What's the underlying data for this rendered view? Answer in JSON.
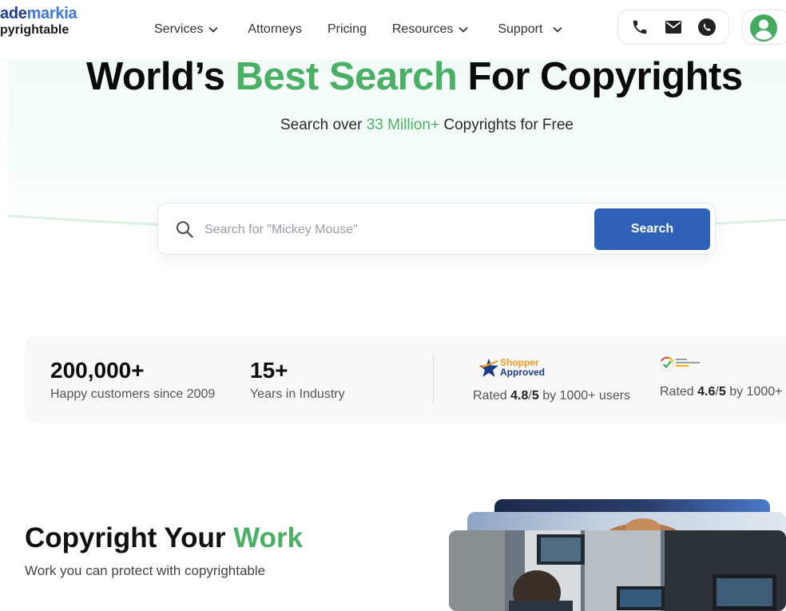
{
  "brand": {
    "line1_part1": "ade",
    "line1_part2": "markia",
    "line2": "pyrightable",
    "colors": {
      "dark_blue": "#1e3d8f",
      "light_blue": "#3f77d2"
    }
  },
  "nav": {
    "items": [
      {
        "label": "Services",
        "has_dropdown": true
      },
      {
        "label": "Attorneys",
        "has_dropdown": false
      },
      {
        "label": "Pricing",
        "has_dropdown": false
      },
      {
        "label": "Resources",
        "has_dropdown": true
      },
      {
        "label": "Support",
        "has_dropdown": true
      }
    ]
  },
  "header_icons": {
    "contact": [
      "phone-icon",
      "mail-icon",
      "whatsapp-icon"
    ],
    "account": "user-account-icon"
  },
  "hero": {
    "title_before": "World’s ",
    "title_highlight": "Best Search",
    "title_after": " For Copyrights",
    "subtitle_before": "Search over ",
    "subtitle_highlight": "33 Million+",
    "subtitle_after": " Copyrights for Free",
    "accent_color": "#4caf66"
  },
  "search": {
    "placeholder": "Search for \"Mickey Mouse\"",
    "value": "",
    "button_label": "Search",
    "button_color": "#2f62b7"
  },
  "stats": {
    "customers_value": "200,000+",
    "customers_label": "Happy customers since 2009",
    "years_value": "15+",
    "years_label": "Years in Industry",
    "shopper_approved": {
      "logo_line1": "Shopper",
      "logo_line2": "Approved",
      "rated_prefix": "Rated ",
      "score": "4.8",
      "slash": "/",
      "out_of": "5",
      "suffix": " by 1000+ users"
    },
    "google_reviews": {
      "logo_text": "Google Customer Reviews",
      "rated_prefix": "Rated ",
      "score": "4.6",
      "slash": "/",
      "out_of": "5",
      "suffix": " by 1000+"
    }
  },
  "section": {
    "title_before": "Copyright Your ",
    "title_highlight": "Work",
    "subtitle": "Work you can protect with copyrightable"
  }
}
